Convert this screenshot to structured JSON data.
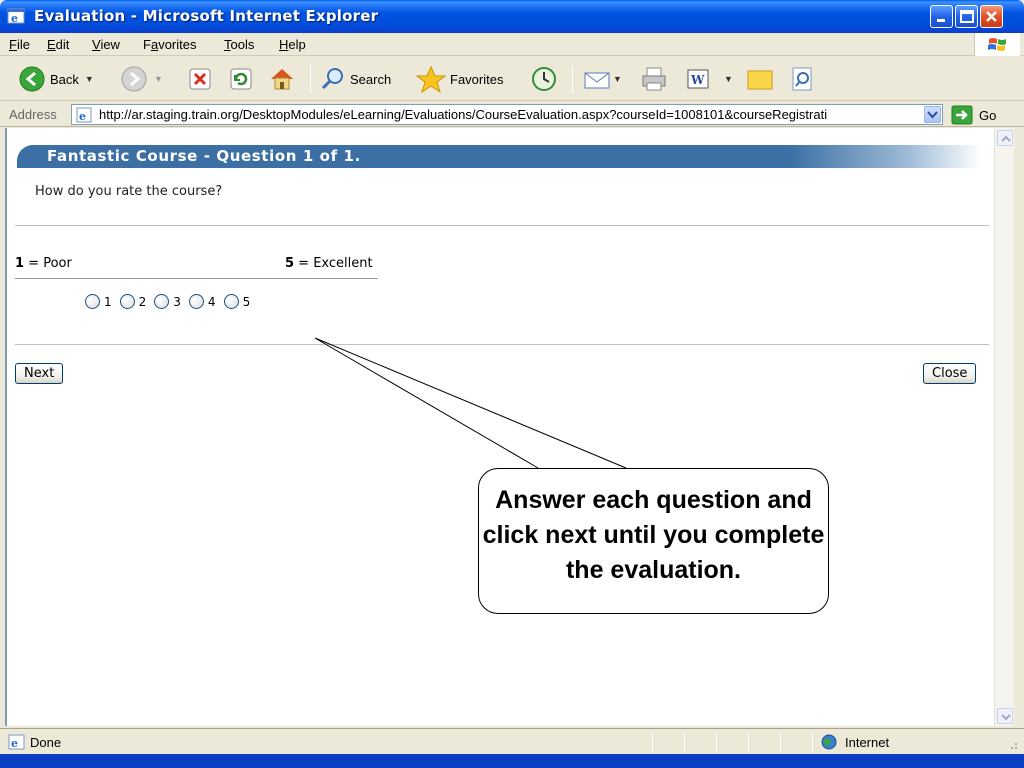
{
  "window": {
    "title": "Evaluation - Microsoft Internet Explorer"
  },
  "menu": [
    {
      "pre": "",
      "ul": "F",
      "post": "ile"
    },
    {
      "pre": "",
      "ul": "E",
      "post": "dit"
    },
    {
      "pre": "",
      "ul": "V",
      "post": "iew"
    },
    {
      "pre": "F",
      "ul": "a",
      "post": "vorites"
    },
    {
      "pre": "",
      "ul": "T",
      "post": "ools"
    },
    {
      "pre": "",
      "ul": "H",
      "post": "elp"
    }
  ],
  "toolbar": {
    "back_label": "Back",
    "search_label": "Search",
    "favorites_label": "Favorites"
  },
  "address": {
    "label": "Address",
    "url": "http://ar.staging.train.org/DesktopModules/eLearning/Evaluations/CourseEvaluation.aspx?courseId=1008101&courseRegistrati",
    "go_label": "Go"
  },
  "page": {
    "header": "Fantastic Course - Question 1 of 1.",
    "question": "How do you rate the course?",
    "scale_low_num": "1",
    "scale_low_text": " = Poor",
    "scale_high_num": "5",
    "scale_high_text": " = Excellent",
    "options": [
      "1",
      "2",
      "3",
      "4",
      "5"
    ],
    "next_label": "Next",
    "close_label": "Close"
  },
  "callout": {
    "text": "Answer each question and click next until you complete the evaluation."
  },
  "status": {
    "text": "Done",
    "zone": "Internet"
  },
  "colors": {
    "header_bar": "#3c70a4",
    "titlebar": "#0053e1"
  }
}
